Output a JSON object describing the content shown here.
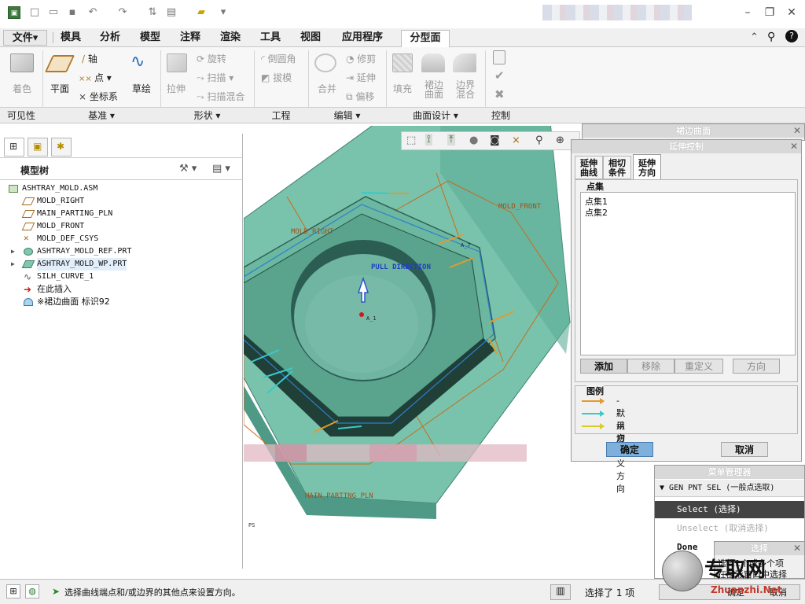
{
  "quick_access": {
    "icons": [
      "app-icon",
      "new-icon",
      "open-icon",
      "save-icon",
      "undo-icon",
      "redo-icon",
      "regenerate-icon",
      "windows-icon",
      "close-window-icon",
      "customize-icon"
    ]
  },
  "menubar": {
    "tabs": [
      "文件",
      "模具",
      "分析",
      "模型",
      "注释",
      "渲染",
      "工具",
      "视图",
      "应用程序",
      "分型面"
    ],
    "file_arrow": "▾",
    "active_tab": "分型面"
  },
  "ribbon": {
    "visibility": {
      "shade": "着色"
    },
    "datum": {
      "plane": "平面",
      "axis": "轴",
      "point": "点",
      "csys": "坐标系",
      "sketch": "草绘"
    },
    "shapes": {
      "extrude": "拉伸",
      "revolve": "旋转",
      "sweep": "扫描",
      "swept_blend": "扫描混合"
    },
    "engineering": {
      "round": "倒圆角",
      "draft": "拔模"
    },
    "editing": {
      "merge": "合并",
      "trim": "修剪",
      "extend": "延伸",
      "offset": "偏移"
    },
    "surface_design": {
      "fill": "填充",
      "skirt": "裙边\n曲面",
      "boundary_blend": "边界\n混合"
    },
    "control": {
      "ok": "✔",
      "cancel": "✖"
    },
    "groups": [
      "可见性",
      "基准 ▾",
      "形状 ▾",
      "工程",
      "编辑 ▾",
      "曲面设计 ▾",
      "控制"
    ]
  },
  "model_tree": {
    "title": "模型树",
    "items": [
      {
        "label": "ASHTRAY_MOLD.ASM",
        "icon": "assembly-icon"
      },
      {
        "label": "MOLD_RIGHT",
        "icon": "datum-plane-icon"
      },
      {
        "label": "MAIN_PARTING_PLN",
        "icon": "datum-plane-icon"
      },
      {
        "label": "MOLD_FRONT",
        "icon": "datum-plane-icon"
      },
      {
        "label": "MOLD_DEF_CSYS",
        "icon": "csys-icon"
      },
      {
        "label": "ASHTRAY_MOLD_REF.PRT",
        "icon": "part-icon",
        "expand": "▶"
      },
      {
        "label": "ASHTRAY_MOLD_WP.PRT",
        "icon": "part-icon",
        "expand": "▶"
      },
      {
        "label": "SILH_CURVE_1",
        "icon": "curve-icon"
      },
      {
        "label": "在此插入",
        "icon": "insert-here-icon"
      },
      {
        "label": "※裙边曲面 标识92",
        "icon": "skirt-surface-icon"
      }
    ]
  },
  "graphics": {
    "labels": {
      "mold_front": "MOLD_FRONT",
      "mold_right": "MOLD_RIGHT",
      "pull_direction": "PULL DIRECTION",
      "main_parting_pln": "MAIN_PARTING_PLN",
      "small_note": "PS",
      "axis_a1": "A_1",
      "axis_a7": "A_7"
    }
  },
  "skirt_dialog": {
    "title": "裙边曲面",
    "close": "✕"
  },
  "extend_dialog": {
    "title": "延伸控制",
    "close": "✕",
    "tabs": [
      "延伸\n曲线",
      "相切\n条件",
      "延伸\n方向"
    ],
    "active_tab": "延伸\n方向",
    "pointset_label": "点集",
    "pointsets": [
      "点集1",
      "点集2"
    ],
    "buttons": {
      "add": "添加",
      "remove": "移除",
      "redefine": "重定义",
      "direction": "方向"
    },
    "legend_label": "图例",
    "legend": [
      {
        "text": "- 默认方向",
        "color": "#e39a2b"
      },
      {
        "text": "- 用户定义方向",
        "color": "#38c9c9"
      },
      {
        "text": "- 切向",
        "color": "#d9cc2a"
      }
    ],
    "ok": "确定",
    "cancel": "取消"
  },
  "menu_manager": {
    "title": "菜单管理器",
    "header": "GEN PNT SEL (一般点选取)",
    "items": [
      "Select (选择)",
      "Unselect (取消选择)",
      "Done"
    ],
    "selected": "Select (选择)"
  },
  "select_dialog": {
    "title": "选择",
    "close": "✕",
    "text1": "选择1个或多个项",
    "text2": "在图形窗口中选择",
    "ok": "确定",
    "cancel": "取消"
  },
  "status": {
    "message": "选择曲线端点和/或边界的其他点来设置方向。",
    "selected": "选择了 1 项"
  },
  "watermark": {
    "text": "专取网",
    "url": "Zhuanzhi.Net"
  },
  "colors": {
    "accent": "#2c6fba",
    "mold_fill": "#6fc0a8",
    "mold_edge": "#3b7a6c"
  }
}
